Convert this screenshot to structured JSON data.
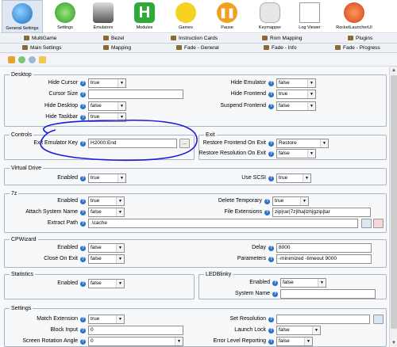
{
  "toolbar": {
    "buttons": [
      {
        "label": "General Settings",
        "icon": "gear-globe-icon",
        "selected": true
      },
      {
        "label": "Settings",
        "icon": "gear-icon",
        "selected": false
      },
      {
        "label": "Emulators",
        "icon": "joystick-icon",
        "selected": false
      },
      {
        "label": "Modules",
        "icon": "h-module-icon",
        "selected": false
      },
      {
        "label": "Games",
        "icon": "pacman-icon",
        "selected": false
      },
      {
        "label": "Pause",
        "icon": "pause-icon",
        "selected": false
      },
      {
        "label": "Keymapper",
        "icon": "gamepad-icon",
        "selected": false
      },
      {
        "label": "Log Viewer",
        "icon": "log-icon",
        "selected": false
      },
      {
        "label": "RocketLauncherUI",
        "icon": "rocket-icon",
        "selected": false
      }
    ]
  },
  "tabs_row1": [
    "MultiGame",
    "Bezel",
    "Instruction Cards",
    "Rom Mapping",
    "Plugins"
  ],
  "tabs_row2": [
    "Main Settings",
    "Mapping",
    "Fade - General",
    "Fade - Info",
    "Fade - Progress"
  ],
  "desktop": {
    "title": "Desktop",
    "hide_cursor": {
      "label": "Hide Cursor",
      "value": "true"
    },
    "cursor_size": {
      "label": "Cursor Size",
      "value": ""
    },
    "hide_desktop": {
      "label": "Hide Desktop",
      "value": "false"
    },
    "hide_taskbar": {
      "label": "Hide Taskbar",
      "value": "true"
    },
    "hide_emulator": {
      "label": "Hide Emulator",
      "value": "false"
    },
    "hide_frontend": {
      "label": "Hide Frontend",
      "value": "true"
    },
    "suspend_frontend": {
      "label": "Suspend Frontend",
      "value": "false"
    }
  },
  "controls": {
    "title": "Controls",
    "exit_key": {
      "label": "Exit Emulator Key",
      "value": "H2000:End",
      "button": "..."
    }
  },
  "exit": {
    "title": "Exit",
    "restore_frontend": {
      "label": "Restore Frontend On Exit",
      "value": "Restore"
    },
    "restore_resolution": {
      "label": "Restore Resolution On Exit",
      "value": "false"
    }
  },
  "virtual_drive": {
    "title": "Virtual Drive",
    "enabled": {
      "label": "Enabled",
      "value": "true"
    },
    "use_scsi": {
      "label": "Use SCSI",
      "value": "true"
    }
  },
  "sevenz": {
    "title": "7z",
    "enabled": {
      "label": "Enabled",
      "value": "true"
    },
    "attach_system_name": {
      "label": "Attach System Name",
      "value": "false"
    },
    "extract_path": {
      "label": "Extract Path",
      "value": ".\\cache"
    },
    "delete_temporary": {
      "label": "Delete Temporary",
      "value": "true"
    },
    "file_extensions": {
      "label": "File Extensions",
      "value": "zip|rar|7z|lha|lzh|gzip|tar"
    }
  },
  "cpwizard": {
    "title": "CPWizard",
    "enabled": {
      "label": "Enabled",
      "value": "false"
    },
    "close_on_exit": {
      "label": "Close On Exit",
      "value": "false"
    },
    "delay": {
      "label": "Delay",
      "value": "8000"
    },
    "parameters": {
      "label": "Parameters",
      "value": "-minimized -timeout 9000"
    }
  },
  "statistics": {
    "title": "Statistics",
    "enabled": {
      "label": "Enabled",
      "value": "false"
    }
  },
  "ledblinky": {
    "title": "LEDBlinky",
    "enabled": {
      "label": "Enabled",
      "value": "false"
    },
    "system_name": {
      "label": "System Name",
      "value": ""
    }
  },
  "settings": {
    "title": "Settings",
    "match_extension": {
      "label": "Match Extension",
      "value": "true"
    },
    "block_input": {
      "label": "Block Input",
      "value": "0"
    },
    "screen_rotation": {
      "label": "Screen Rotation Angle",
      "value": "0"
    },
    "set_resolution": {
      "label": "Set Resolution",
      "value": ""
    },
    "launch_lock": {
      "label": "Launch Lock",
      "value": "false"
    },
    "error_level": {
      "label": "Error Level Reporting",
      "value": "false"
    }
  },
  "help_glyph": "?",
  "dropdown_arrow": "▼",
  "accent_color": "#2e73c8",
  "annotation_color": "#1a1adc"
}
